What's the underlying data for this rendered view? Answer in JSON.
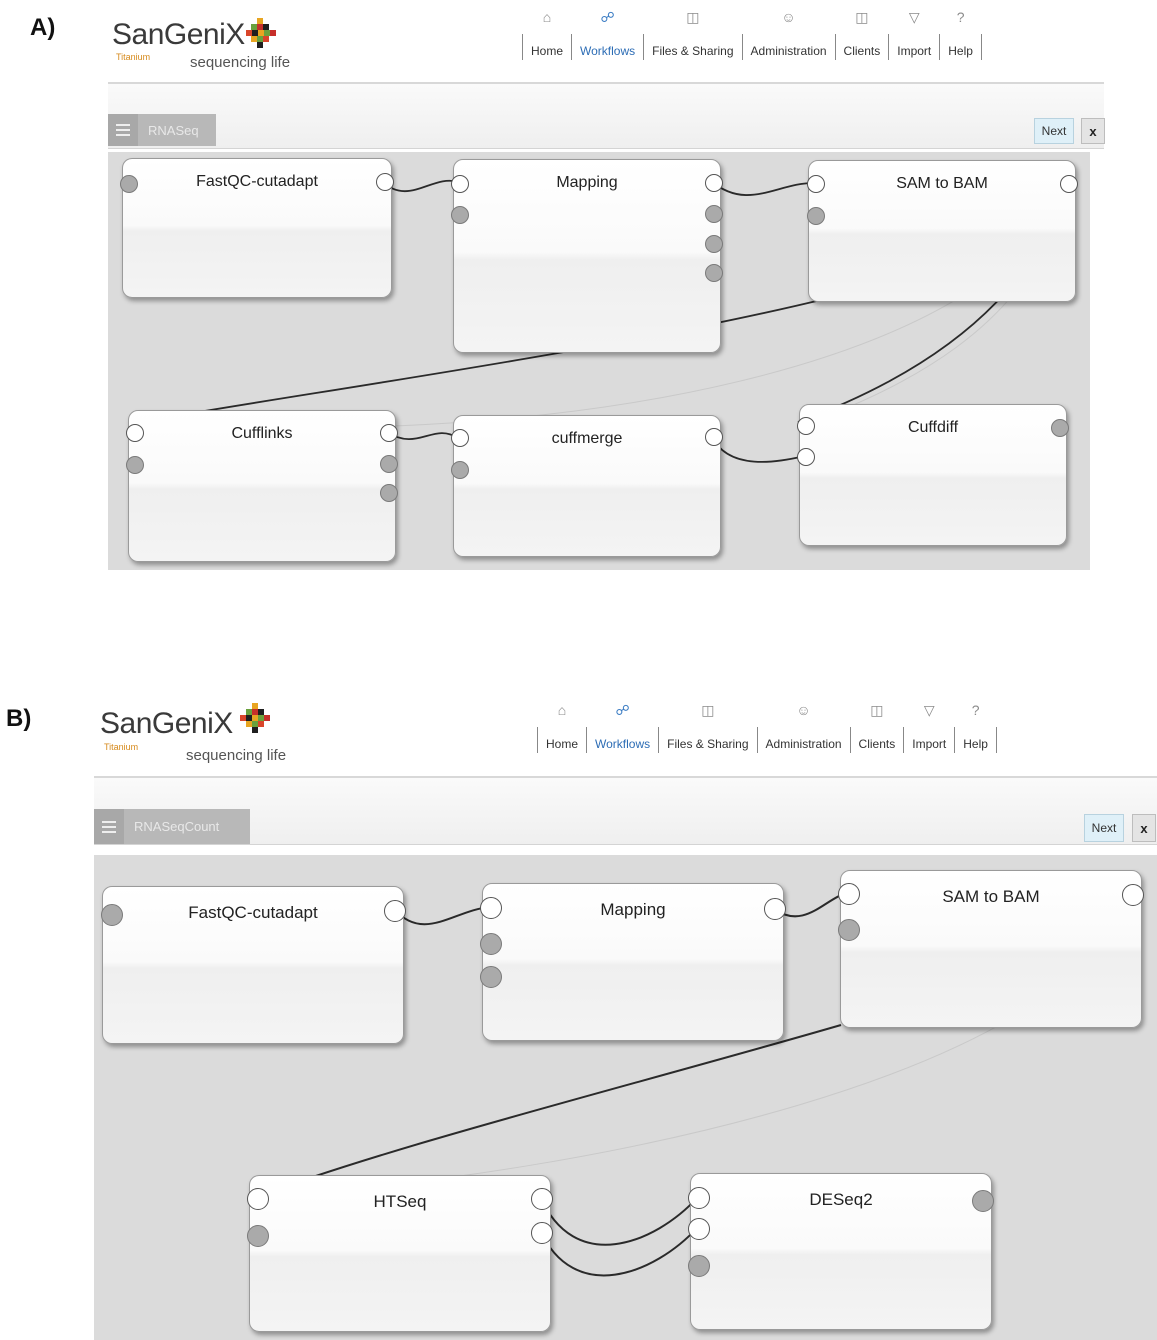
{
  "panels": [
    {
      "label": "A)",
      "logo": {
        "name": "SanGeniX",
        "subtitle": "Titanium",
        "tagline": "sequencing life"
      },
      "nav": [
        {
          "label": "Home",
          "icon": "home-icon"
        },
        {
          "label": "Workflows",
          "icon": "workflows-icon",
          "active": true
        },
        {
          "label": "Files & Sharing",
          "icon": "files-icon"
        },
        {
          "label": "Administration",
          "icon": "users-icon"
        },
        {
          "label": "Clients",
          "icon": "clients-icon"
        },
        {
          "label": "Import",
          "icon": "import-icon"
        },
        {
          "label": "Help",
          "icon": "help-icon"
        }
      ],
      "workflow_tab": "RNASeq",
      "next_label": "Next",
      "close_label": "x",
      "nodes": [
        {
          "title": "FastQC-cutadapt"
        },
        {
          "title": "Mapping"
        },
        {
          "title": "SAM to BAM"
        },
        {
          "title": "Cufflinks"
        },
        {
          "title": "cuffmerge"
        },
        {
          "title": "Cuffdiff"
        }
      ]
    },
    {
      "label": "B)",
      "logo": {
        "name": "SanGeniX",
        "subtitle": "Titanium",
        "tagline": "sequencing life"
      },
      "nav": [
        {
          "label": "Home",
          "icon": "home-icon"
        },
        {
          "label": "Workflows",
          "icon": "workflows-icon",
          "active": true
        },
        {
          "label": "Files & Sharing",
          "icon": "files-icon"
        },
        {
          "label": "Administration",
          "icon": "users-icon"
        },
        {
          "label": "Clients",
          "icon": "clients-icon"
        },
        {
          "label": "Import",
          "icon": "import-icon"
        },
        {
          "label": "Help",
          "icon": "help-icon"
        }
      ],
      "workflow_tab": "RNASeqCount",
      "next_label": "Next",
      "close_label": "x",
      "nodes": [
        {
          "title": "FastQC-cutadapt"
        },
        {
          "title": "Mapping"
        },
        {
          "title": "SAM to BAM"
        },
        {
          "title": "HTSeq"
        },
        {
          "title": "DESeq2"
        }
      ]
    }
  ]
}
